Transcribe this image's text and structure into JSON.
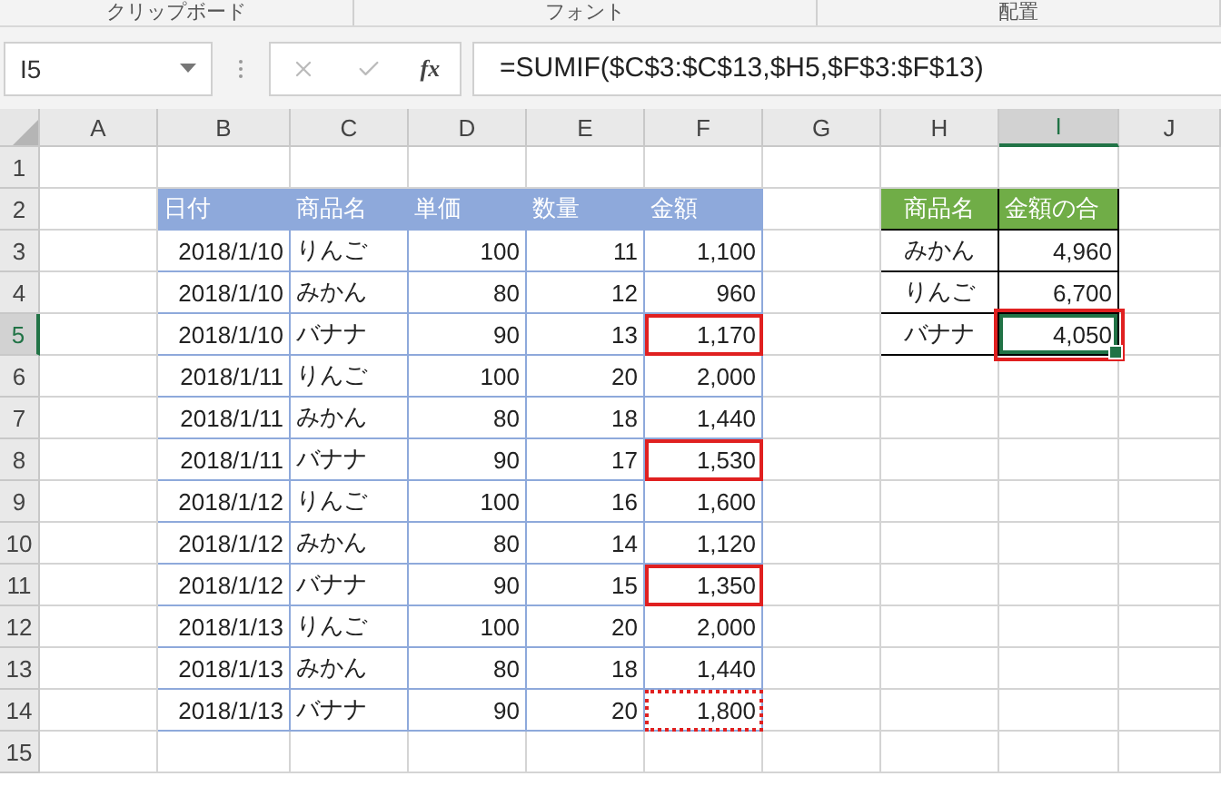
{
  "ribbon_groups": [
    {
      "label": "クリップボード"
    },
    {
      "label": "フォント"
    },
    {
      "label": "配置"
    }
  ],
  "formula_bar": {
    "name_box": "I5",
    "fx": "fx",
    "formula": "=SUMIF($C$3:$C$13,$H5,$F$3:$F$13)"
  },
  "column_headers": [
    {
      "label": "A",
      "selected": false
    },
    {
      "label": "B",
      "selected": false
    },
    {
      "label": "C",
      "selected": false
    },
    {
      "label": "D",
      "selected": false
    },
    {
      "label": "E",
      "selected": false
    },
    {
      "label": "F",
      "selected": false
    },
    {
      "label": "G",
      "selected": false
    },
    {
      "label": "H",
      "selected": false
    },
    {
      "label": "I",
      "selected": true
    },
    {
      "label": "J",
      "selected": false
    }
  ],
  "row_headers": [
    {
      "label": "1",
      "selected": false
    },
    {
      "label": "2",
      "selected": false
    },
    {
      "label": "3",
      "selected": false
    },
    {
      "label": "4",
      "selected": false
    },
    {
      "label": "5",
      "selected": true
    },
    {
      "label": "6",
      "selected": false
    },
    {
      "label": "7",
      "selected": false
    },
    {
      "label": "8",
      "selected": false
    },
    {
      "label": "9",
      "selected": false
    },
    {
      "label": "10",
      "selected": false
    },
    {
      "label": "11",
      "selected": false
    },
    {
      "label": "12",
      "selected": false
    },
    {
      "label": "13",
      "selected": false
    },
    {
      "label": "14",
      "selected": false
    },
    {
      "label": "15",
      "selected": false
    }
  ],
  "sales_table": {
    "columns": [
      "日付",
      "商品名",
      "単価",
      "数量",
      "金額"
    ],
    "rows": [
      {
        "date": "2018/1/10",
        "product": "りんご",
        "price": "100",
        "qty": "11",
        "amount": "1,100",
        "highlighted": false,
        "copy_marquee": false
      },
      {
        "date": "2018/1/10",
        "product": "みかん",
        "price": "80",
        "qty": "12",
        "amount": "960",
        "highlighted": false,
        "copy_marquee": false
      },
      {
        "date": "2018/1/10",
        "product": "バナナ",
        "price": "90",
        "qty": "13",
        "amount": "1,170",
        "highlighted": true,
        "copy_marquee": false
      },
      {
        "date": "2018/1/11",
        "product": "りんご",
        "price": "100",
        "qty": "20",
        "amount": "2,000",
        "highlighted": false,
        "copy_marquee": false
      },
      {
        "date": "2018/1/11",
        "product": "みかん",
        "price": "80",
        "qty": "18",
        "amount": "1,440",
        "highlighted": false,
        "copy_marquee": false
      },
      {
        "date": "2018/1/11",
        "product": "バナナ",
        "price": "90",
        "qty": "17",
        "amount": "1,530",
        "highlighted": true,
        "copy_marquee": false
      },
      {
        "date": "2018/1/12",
        "product": "りんご",
        "price": "100",
        "qty": "16",
        "amount": "1,600",
        "highlighted": false,
        "copy_marquee": false
      },
      {
        "date": "2018/1/12",
        "product": "みかん",
        "price": "80",
        "qty": "14",
        "amount": "1,120",
        "highlighted": false,
        "copy_marquee": false
      },
      {
        "date": "2018/1/12",
        "product": "バナナ",
        "price": "90",
        "qty": "15",
        "amount": "1,350",
        "highlighted": true,
        "copy_marquee": false
      },
      {
        "date": "2018/1/13",
        "product": "りんご",
        "price": "100",
        "qty": "20",
        "amount": "2,000",
        "highlighted": false,
        "copy_marquee": false
      },
      {
        "date": "2018/1/13",
        "product": "みかん",
        "price": "80",
        "qty": "18",
        "amount": "1,440",
        "highlighted": false,
        "copy_marquee": false
      },
      {
        "date": "2018/1/13",
        "product": "バナナ",
        "price": "90",
        "qty": "20",
        "amount": "1,800",
        "highlighted": false,
        "copy_marquee": true
      }
    ]
  },
  "summary_table": {
    "columns": [
      "商品名",
      "金額の合"
    ],
    "rows": [
      {
        "product": "みかん",
        "total": "4,960",
        "selected": false
      },
      {
        "product": "りんご",
        "total": "6,700",
        "selected": false
      },
      {
        "product": "バナナ",
        "total": "4,050",
        "selected": true
      }
    ]
  }
}
